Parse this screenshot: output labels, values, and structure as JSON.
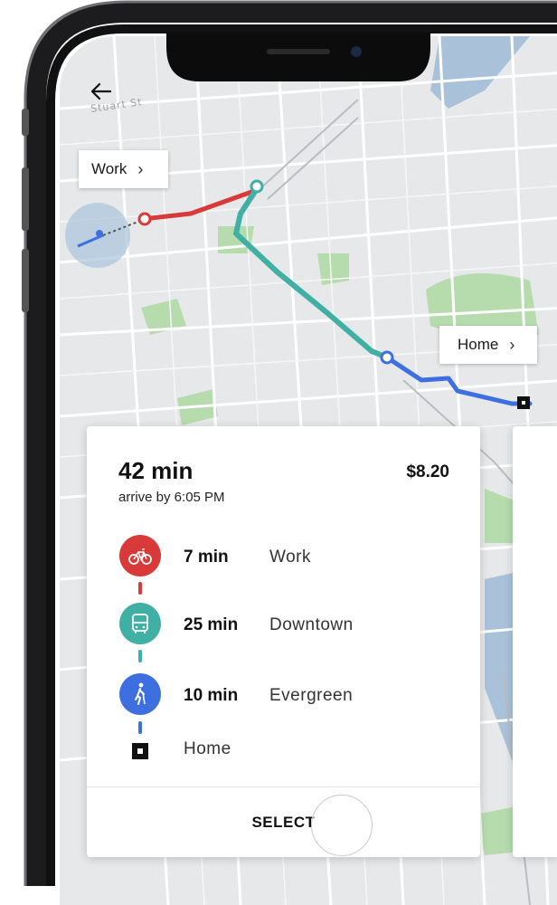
{
  "map": {
    "street_label": "Stuart St",
    "pins": {
      "work_label": "Work",
      "home_label": "Home"
    },
    "colors": {
      "bike_route": "#d83a3a",
      "transit_route": "#3fb0a3",
      "walk_route": "#3e6fe0",
      "parks": "#b6dcae",
      "water": "#a9c2d9"
    }
  },
  "trip": {
    "duration": "42 min",
    "arrive_by": "arrive by 6:05 PM",
    "price": "$8.20",
    "steps": [
      {
        "mode_icon": "bicycle-icon",
        "color": "#d83a3a",
        "time": "7 min",
        "place": "Work"
      },
      {
        "mode_icon": "bus-icon",
        "color": "#3fb0a3",
        "time": "25 min",
        "place": "Downtown"
      },
      {
        "mode_icon": "walking-icon",
        "color": "#3e6fe0",
        "time": "10 min",
        "place": "Evergreen"
      }
    ],
    "destination": "Home",
    "select_label": "SELECT"
  }
}
